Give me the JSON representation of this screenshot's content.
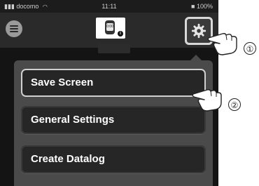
{
  "status_bar": {
    "carrier": "docomo",
    "time": "11:11",
    "battery_text": "■ 100%"
  },
  "navbar": {
    "device_label": "0:00"
  },
  "dropdown_menu": {
    "items": [
      {
        "label": "Save Screen"
      },
      {
        "label": "General Settings"
      },
      {
        "label": "Create Datalog"
      }
    ]
  },
  "callouts": {
    "one": "①",
    "two": "②"
  },
  "colors": {
    "background": "#1c1c1c",
    "menu_panel": "#4a4a4a",
    "menu_item": "#262626",
    "highlight_border": "#d8d8d8"
  },
  "icons": [
    "menu-icon",
    "watch-icon",
    "info-icon",
    "gear-icon",
    "pointing-hand-icon"
  ]
}
